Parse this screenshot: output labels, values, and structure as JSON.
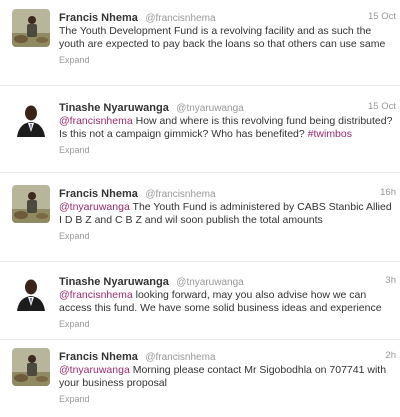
{
  "tweets": [
    {
      "author": "Francis Nhema",
      "handle": "@francisnhema",
      "time": "15 Oct",
      "text": "The Youth Development Fund is a revolving facility and as such the youth are expected to pay back the loans so that others can use same",
      "expand": "Expand"
    },
    {
      "author": "Tinashe Nyaruwanga",
      "handle": "@tnyaruwanga",
      "time": "15 Oct",
      "mention": "@francisnhema",
      "text": " How and where is this revolving fund being distributed? Is this not a campaign gimmick? Who has benefited? ",
      "hashtag": "#twimbos",
      "expand": "Expand"
    },
    {
      "author": "Francis Nhema",
      "handle": "@francisnhema",
      "time": "16h",
      "mention": "@tnyaruwanga",
      "text": " The Youth Fund is administered by CABS Stanbic Allied I D B Z and C B Z and wil soon publish the total amounts",
      "expand": "Expand"
    },
    {
      "author": "Tinashe Nyaruwanga",
      "handle": "@tnyaruwanga",
      "time": "3h",
      "mention": "@francisnhema",
      "text": " looking forward, may you also advise how we can access this fund. We have some solid business ideas and experience",
      "expand": "Expand"
    },
    {
      "author": "Francis Nhema",
      "handle": "@francisnhema",
      "time": "2h",
      "mention": "@tnyaruwanga",
      "text": " Morning please contact Mr Sigobodhla on 707741 with your business proposal",
      "expand": "Expand"
    }
  ]
}
